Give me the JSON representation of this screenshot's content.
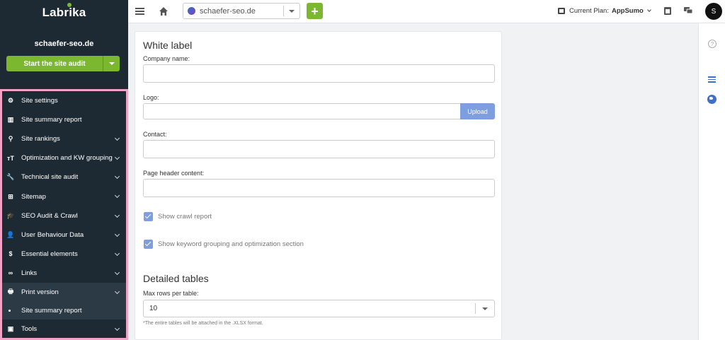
{
  "app": {
    "logo": "Labrika"
  },
  "sidebar": {
    "site_name": "schaefer-seo.de",
    "audit_button": "Start the site audit",
    "items": [
      {
        "label": "Site settings",
        "icon": "gear-icon",
        "glyph": "⚙"
      },
      {
        "label": "Site summary report",
        "icon": "chart-icon",
        "glyph": "▥"
      },
      {
        "label": "Site rankings",
        "icon": "search-icon",
        "glyph": "⚲"
      },
      {
        "label": "Optimization and KW grouping",
        "icon": "text-size-icon",
        "glyph": "тT"
      },
      {
        "label": "Technical site audit",
        "icon": "wrench-icon",
        "glyph": "🔧"
      },
      {
        "label": "Sitemap",
        "icon": "sitemap-icon",
        "glyph": "⊞"
      },
      {
        "label": "SEO Audit & Crawl",
        "icon": "graduation-cap-icon",
        "glyph": "🎓"
      },
      {
        "label": "User Behaviour Data",
        "icon": "user-icon",
        "glyph": "👤"
      },
      {
        "label": "Essential elements",
        "icon": "dollar-icon",
        "glyph": "$"
      },
      {
        "label": "Links",
        "icon": "link-icon",
        "glyph": "∞"
      },
      {
        "label": "Print version",
        "icon": "printer-icon",
        "glyph": "🖶"
      },
      {
        "label": "Tools",
        "icon": "toolbox-icon",
        "glyph": "▣"
      }
    ],
    "sub_item": "Site summary report"
  },
  "topbar": {
    "site_select": "schaefer-seo.de",
    "plus": "+",
    "plan_label": "Current Plan:",
    "plan_value": "AppSumo",
    "avatar": "S"
  },
  "form": {
    "title": "White label",
    "company_label": "Company name:",
    "company_value": "",
    "logo_label": "Logo:",
    "upload_label": "Upload",
    "contact_label": "Contact:",
    "contact_value": "",
    "header_label": "Page header content:",
    "header_value": "",
    "check1": "Show crawl report",
    "check2": "Show keyword grouping and optimization section",
    "tables_title": "Detailed tables",
    "max_rows_label": "Max rows per table:",
    "max_rows_value": "10",
    "note": "*The entire tables will be attached in the .XLSX format."
  },
  "right_rail": {
    "help": "?"
  },
  "colors": {
    "sidebar": "#1e2a33",
    "accent_green": "#7cb82f",
    "accent_blue": "#7f9ee0",
    "highlight": "#f2a2c5"
  }
}
